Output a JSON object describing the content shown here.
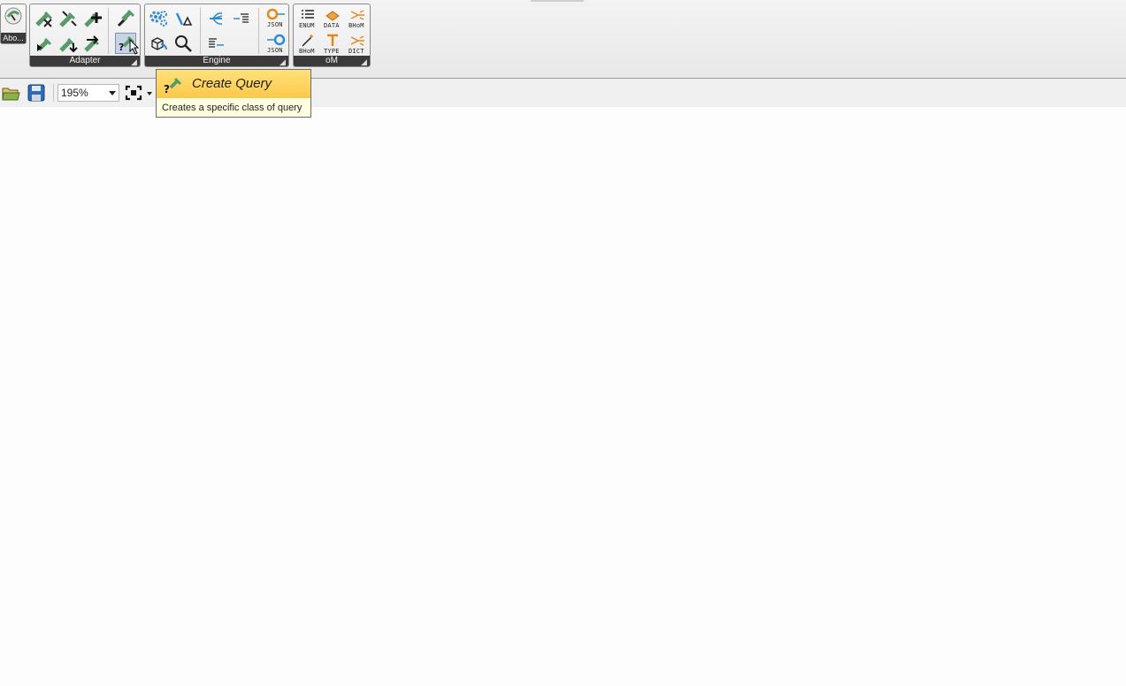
{
  "ribbon": {
    "about_label": "Abo...",
    "panels": [
      {
        "name": "Adapter"
      },
      {
        "name": "Engine"
      },
      {
        "name": "oM"
      }
    ],
    "engine_icons": {
      "json_top": "JSON",
      "json_bottom": "JSON"
    },
    "om_icons": {
      "enum": "ENUM",
      "data": "DATA",
      "bhom_top": "BHoM",
      "bhom_bottom": "BHoM",
      "type": "TYPE",
      "dict": "DICT"
    }
  },
  "toolbar": {
    "zoom_value": "195%"
  },
  "tooltip": {
    "title": "Create Query",
    "description": "Creates a specific class of query"
  },
  "colors": {
    "adapter_green": "#5a9a6a",
    "engine_blue": "#2e8ad8",
    "om_orange": "#e08a1e",
    "tooltip_header": "#fcc84b",
    "tooltip_body": "#ffffe1",
    "panel_footer": "#3a3a3a"
  }
}
